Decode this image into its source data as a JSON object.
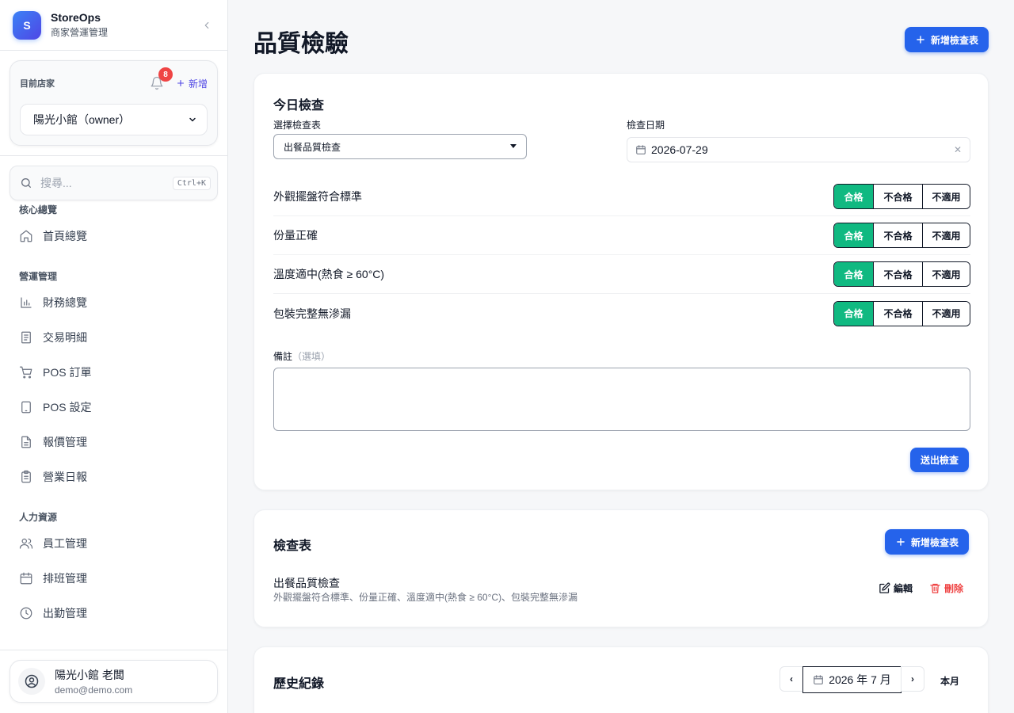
{
  "brand": {
    "logo_letter": "S",
    "name": "StoreOps",
    "subtitle": "商家營運管理"
  },
  "store": {
    "label": "目前店家",
    "notification_count": "8",
    "add_label": "新增",
    "selected": "陽光小館（owner）"
  },
  "search": {
    "placeholder": "搜尋...",
    "shortcut": "Ctrl+K"
  },
  "nav": {
    "groups": [
      {
        "title": "核心總覽",
        "items": [
          {
            "label": "首頁總覽",
            "icon": "home-icon"
          }
        ]
      },
      {
        "title": "營運管理",
        "items": [
          {
            "label": "財務總覽",
            "icon": "bar-chart-icon"
          },
          {
            "label": "交易明細",
            "icon": "document-icon"
          },
          {
            "label": "POS 訂單",
            "icon": "cart-icon"
          },
          {
            "label": "POS 設定",
            "icon": "tablet-icon"
          },
          {
            "label": "報價管理",
            "icon": "file-text-icon"
          },
          {
            "label": "營業日報",
            "icon": "clipboard-icon"
          }
        ]
      },
      {
        "title": "人力資源",
        "items": [
          {
            "label": "員工管理",
            "icon": "users-icon"
          },
          {
            "label": "排班管理",
            "icon": "calendar-icon"
          },
          {
            "label": "出勤管理",
            "icon": "clock-icon"
          }
        ]
      }
    ]
  },
  "user": {
    "name": "陽光小館 老闆",
    "email": "demo@demo.com"
  },
  "page": {
    "title": "品質檢驗",
    "new_template_label": "新增檢查表"
  },
  "today": {
    "title": "今日檢查",
    "template_label": "選擇檢查表",
    "template_value": "出餐品質檢查",
    "date_label": "檢查日期",
    "date_value": "2026-07-29",
    "options": [
      "合格",
      "不合格",
      "不適用"
    ],
    "items": [
      {
        "name": "外觀擺盤符合標準",
        "selected": "合格"
      },
      {
        "name": "份量正確",
        "selected": "合格"
      },
      {
        "name": "溫度適中(熱食 ≥ 60°C)",
        "selected": "合格"
      },
      {
        "name": "包裝完整無滲漏",
        "selected": "合格"
      }
    ],
    "note_label": "備註",
    "note_optional": "（選填）",
    "note_value": "",
    "submit_label": "送出檢查"
  },
  "templates": {
    "title": "檢查表",
    "new_label": "新增檢查表",
    "list": [
      {
        "name": "出餐品質檢查",
        "items": "外觀擺盤符合標準、份量正確、溫度適中(熱食 ≥ 60°C)、包裝完整無滲漏"
      }
    ],
    "edit_label": "編輯",
    "delete_label": "刪除"
  },
  "history": {
    "title": "歷史紀錄",
    "prev": "‹",
    "month": "2026 年 7 月",
    "next": "›",
    "this_month": "本月"
  },
  "colors": {
    "primary": "#2563eb",
    "pass": "#10b981",
    "danger": "#ef4444",
    "accent": "#4f46e5"
  }
}
